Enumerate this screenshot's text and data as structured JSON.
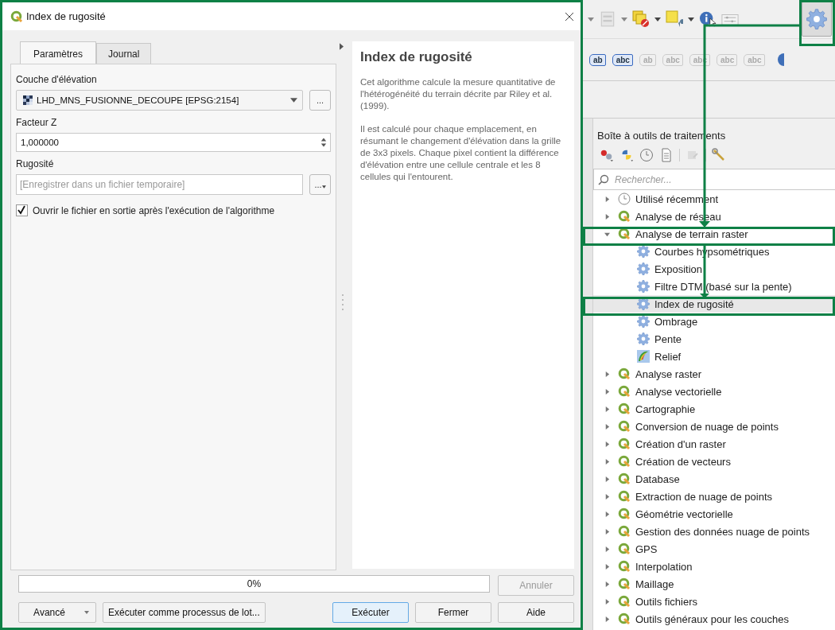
{
  "dialog": {
    "title": "Index de rugosité",
    "tabs": [
      {
        "label": "Paramètres",
        "selected": true
      },
      {
        "label": "Journal",
        "selected": false
      }
    ],
    "params": [
      {
        "kind": "layer",
        "label": "Couche d'élévation",
        "value": "LHD_MNS_FUSIONNE_DECOUPE [EPSG:2154]",
        "button": "..."
      },
      {
        "kind": "number",
        "label": "Facteur Z",
        "value": "1,000000"
      },
      {
        "kind": "output",
        "label": "Rugosité",
        "placeholder": "[Enregistrer dans un fichier temporaire]",
        "button": "..."
      }
    ],
    "open_output": {
      "label": "Ouvrir le fichier en sortie après l'exécution de l'algorithme",
      "checked": true
    },
    "help": {
      "title": "Index de rugosité",
      "paragraphs": [
        "Cet algorithme calcule la mesure quantitative de l'hétérogénéité du terrain décrite par Riley et al. (1999).",
        "Il est calculé pour chaque emplacement, en résumant le changement d'élévation dans la grille de 3x3 pixels. Chaque pixel contient la différence d'élévation entre une cellule centrale et les 8 cellules qui l'entourent."
      ]
    },
    "progress": {
      "level": 0,
      "text": "0%"
    },
    "cancel_button": {
      "label": "Annuler",
      "disabled": true
    },
    "left_buttons": [
      {
        "label": "Avancé",
        "kind": "menu"
      },
      {
        "label": "Exécuter comme processus de lot...",
        "kind": "plain"
      }
    ],
    "right_buttons": [
      {
        "label": "Exécuter",
        "focused": true
      },
      {
        "label": "Fermer",
        "focused": false
      },
      {
        "label": "Aide",
        "focused": false
      }
    ]
  },
  "label_toolbar": [
    {
      "text": "ab",
      "disabled": false
    },
    {
      "text": "abc",
      "disabled": false
    },
    {
      "text": "ab",
      "disabled": true
    },
    {
      "text": "abc",
      "disabled": true
    },
    {
      "text": "abc",
      "disabled": true
    },
    {
      "text": "abc",
      "disabled": true
    },
    {
      "text": "abc",
      "disabled": true
    }
  ],
  "toolbox": {
    "title": "Boîte à outils de traitements",
    "search": {
      "placeholder": "Rechercher..."
    },
    "tree": [
      {
        "label": "Utilisé récemment",
        "kind": "recent",
        "expanded": false,
        "selected": false
      },
      {
        "label": "Analyse de réseau",
        "kind": "provider",
        "expanded": false,
        "selected": false
      },
      {
        "label": "Analyse de terrain raster",
        "kind": "provider",
        "expanded": true,
        "selected": false,
        "children": [
          {
            "label": "Courbes hypsométriques",
            "kind": "algorithm",
            "selected": false
          },
          {
            "label": "Exposition",
            "kind": "algorithm",
            "selected": false
          },
          {
            "label": "Filtre DTM (basé sur la pente)",
            "kind": "algorithm",
            "selected": false
          },
          {
            "label": "Index de rugosité",
            "kind": "algorithm",
            "selected": true
          },
          {
            "label": "Ombrage",
            "kind": "algorithm",
            "selected": false
          },
          {
            "label": "Pente",
            "kind": "algorithm",
            "selected": false
          },
          {
            "label": "Relief",
            "kind": "relief",
            "selected": false
          }
        ]
      },
      {
        "label": "Analyse raster",
        "kind": "provider",
        "expanded": false,
        "selected": false
      },
      {
        "label": "Analyse vectorielle",
        "kind": "provider",
        "expanded": false,
        "selected": false
      },
      {
        "label": "Cartographie",
        "kind": "provider",
        "expanded": false,
        "selected": false
      },
      {
        "label": "Conversion de nuage de points",
        "kind": "provider",
        "expanded": false,
        "selected": false
      },
      {
        "label": "Création d'un raster",
        "kind": "provider",
        "expanded": false,
        "selected": false
      },
      {
        "label": "Création de vecteurs",
        "kind": "provider",
        "expanded": false,
        "selected": false
      },
      {
        "label": "Database",
        "kind": "provider",
        "expanded": false,
        "selected": false
      },
      {
        "label": "Extraction de nuage de points",
        "kind": "provider",
        "expanded": false,
        "selected": false
      },
      {
        "label": "Géométrie vectorielle",
        "kind": "provider",
        "expanded": false,
        "selected": false
      },
      {
        "label": "Gestion des données nuage de points",
        "kind": "provider",
        "expanded": false,
        "selected": false
      },
      {
        "label": "GPS",
        "kind": "provider",
        "expanded": false,
        "selected": false
      },
      {
        "label": "Interpolation",
        "kind": "provider",
        "expanded": false,
        "selected": false
      },
      {
        "label": "Maillage",
        "kind": "provider",
        "expanded": false,
        "selected": false
      },
      {
        "label": "Outils fichiers",
        "kind": "provider",
        "expanded": false,
        "selected": false
      },
      {
        "label": "Outils généraux pour les couches",
        "kind": "provider",
        "expanded": false,
        "selected": false
      }
    ]
  }
}
